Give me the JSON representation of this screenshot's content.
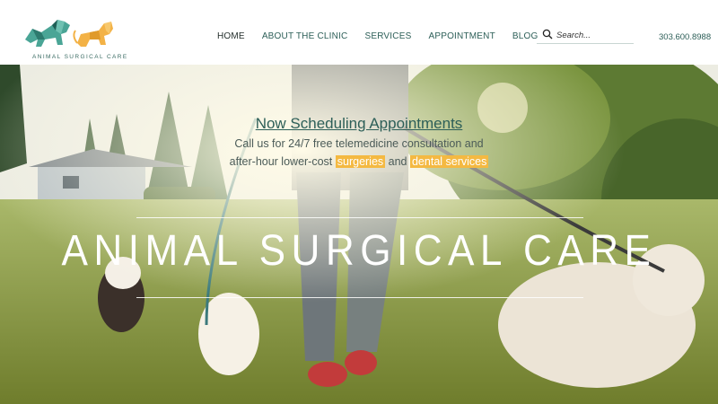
{
  "brand": {
    "name": "ANIMAL SURGICAL CARE"
  },
  "nav": {
    "items": [
      {
        "label": "HOME",
        "active": true
      },
      {
        "label": "ABOUT THE CLINIC",
        "active": false
      },
      {
        "label": "SERVICES",
        "active": false
      },
      {
        "label": "APPOINTMENT",
        "active": false
      },
      {
        "label": "BLOG",
        "active": false
      }
    ]
  },
  "search": {
    "placeholder": "Search..."
  },
  "contact": {
    "phone": "303.600.8988"
  },
  "hero": {
    "heading": "Now Scheduling Appointments",
    "line1": "Call us for 24/7 free telemedicine consultation and",
    "line2_before": "after-hour lower-cost ",
    "line2_link1": "surgeries",
    "line2_mid": " and ",
    "line2_link2": "dental services",
    "big_title": "ANIMAL SURGICAL CARE"
  },
  "colors": {
    "brand_teal": "#2d5f58",
    "highlight": "#f4b942"
  }
}
